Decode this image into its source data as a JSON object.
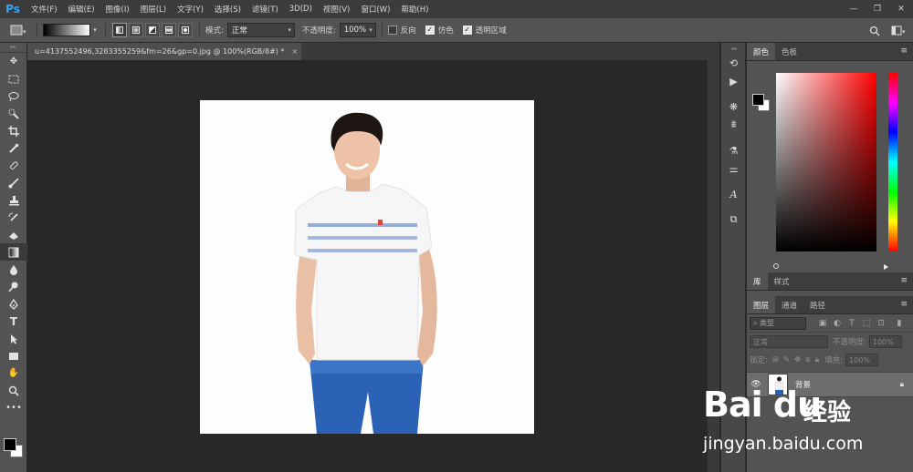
{
  "app": {
    "logo": "Ps"
  },
  "menu": [
    "文件(F)",
    "编辑(E)",
    "图像(I)",
    "图层(L)",
    "文字(Y)",
    "选择(S)",
    "滤镜(T)",
    "3D(D)",
    "视图(V)",
    "窗口(W)",
    "帮助(H)"
  ],
  "window_controls": {
    "minimize": "—",
    "restore": "❐",
    "close": "✕"
  },
  "options": {
    "mode_label": "模式:",
    "mode_value": "正常",
    "opacity_label": "不透明度:",
    "opacity_value": "100%",
    "reverse_label": "反向",
    "reverse_checked": false,
    "dither_label": "仿色",
    "dither_checked": true,
    "transparency_label": "透明区域",
    "transparency_checked": true
  },
  "document": {
    "tab_title": "u=4137552496,3283355259&fm=26&gp=0.jpg @ 100%(RGB/8#) *",
    "close": "×"
  },
  "color_panel": {
    "tabs": [
      "颜色",
      "色板"
    ],
    "foreground": "#000000",
    "background": "#ffffff"
  },
  "library_panel": {
    "tabs": [
      "库",
      "样式"
    ]
  },
  "layers_panel": {
    "tabs": [
      "图层",
      "通道",
      "路径"
    ],
    "kind_label": "类型",
    "blend_mode": "正常",
    "opacity_label": "不透明度:",
    "opacity_value": "100%",
    "lock_label": "锁定:",
    "fill_label": "填充:",
    "fill_value": "100%",
    "layers": [
      {
        "name": "背景",
        "visible": true,
        "locked": true
      }
    ]
  },
  "watermark": {
    "logo": "Bai du",
    "text": "经验",
    "url": "jingyan.baidu.com"
  }
}
